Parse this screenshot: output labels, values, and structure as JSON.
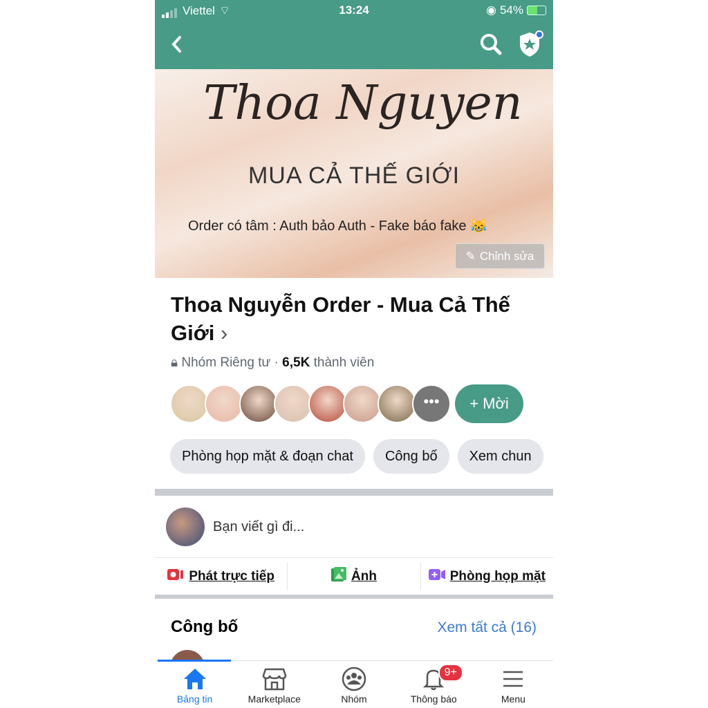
{
  "status": {
    "carrier": "Viettel",
    "time": "13:24",
    "battery": "54%"
  },
  "cover": {
    "script_title": "Thoa Nguyen",
    "tagline": "MUA CẢ THẾ GIỚI",
    "slogan": "Order có tâm : Auth bảo Auth - Fake báo fake 😹",
    "edit_label": "Chỉnh sửa"
  },
  "group": {
    "name": "Thoa Nguyễn Order - Mua Cả Thế Giới",
    "privacy": "Nhóm Riêng tư ·",
    "members_count": "6,5K",
    "members_label": "thành viên",
    "invite_label": "+ Mời"
  },
  "member_avatar_colors": [
    "#d8c8a0",
    "#e8b8a8",
    "#6a4a3a",
    "#d8c0b0",
    "#b84a3a",
    "#c89a8a",
    "#7a6a4a",
    "#a08a8a"
  ],
  "chips": [
    "Phòng họp mặt & đoạn chat",
    "Công bố",
    "Xem chun"
  ],
  "composer": {
    "placeholder": "Bạn viết gì đi..."
  },
  "actions": [
    {
      "label": "Phát trực tiếp",
      "icon": "live-video-icon",
      "color": "#e4333f"
    },
    {
      "label": "Ảnh",
      "icon": "photo-icon",
      "color": "#45bd62"
    },
    {
      "label": "Phòng họp mặt",
      "icon": "room-icon",
      "color": "#9360f7"
    }
  ],
  "announcements": {
    "title": "Công bố",
    "see_all": "Xem tất cả (16)"
  },
  "tabs": [
    {
      "label": "Bảng tin",
      "active": true
    },
    {
      "label": "Marketplace"
    },
    {
      "label": "Nhóm"
    },
    {
      "label": "Thông báo",
      "badge": "9+"
    },
    {
      "label": "Menu"
    }
  ],
  "colors": {
    "brand": "#479b87",
    "link": "#3b7ad8",
    "active_tab": "#1877f2"
  }
}
